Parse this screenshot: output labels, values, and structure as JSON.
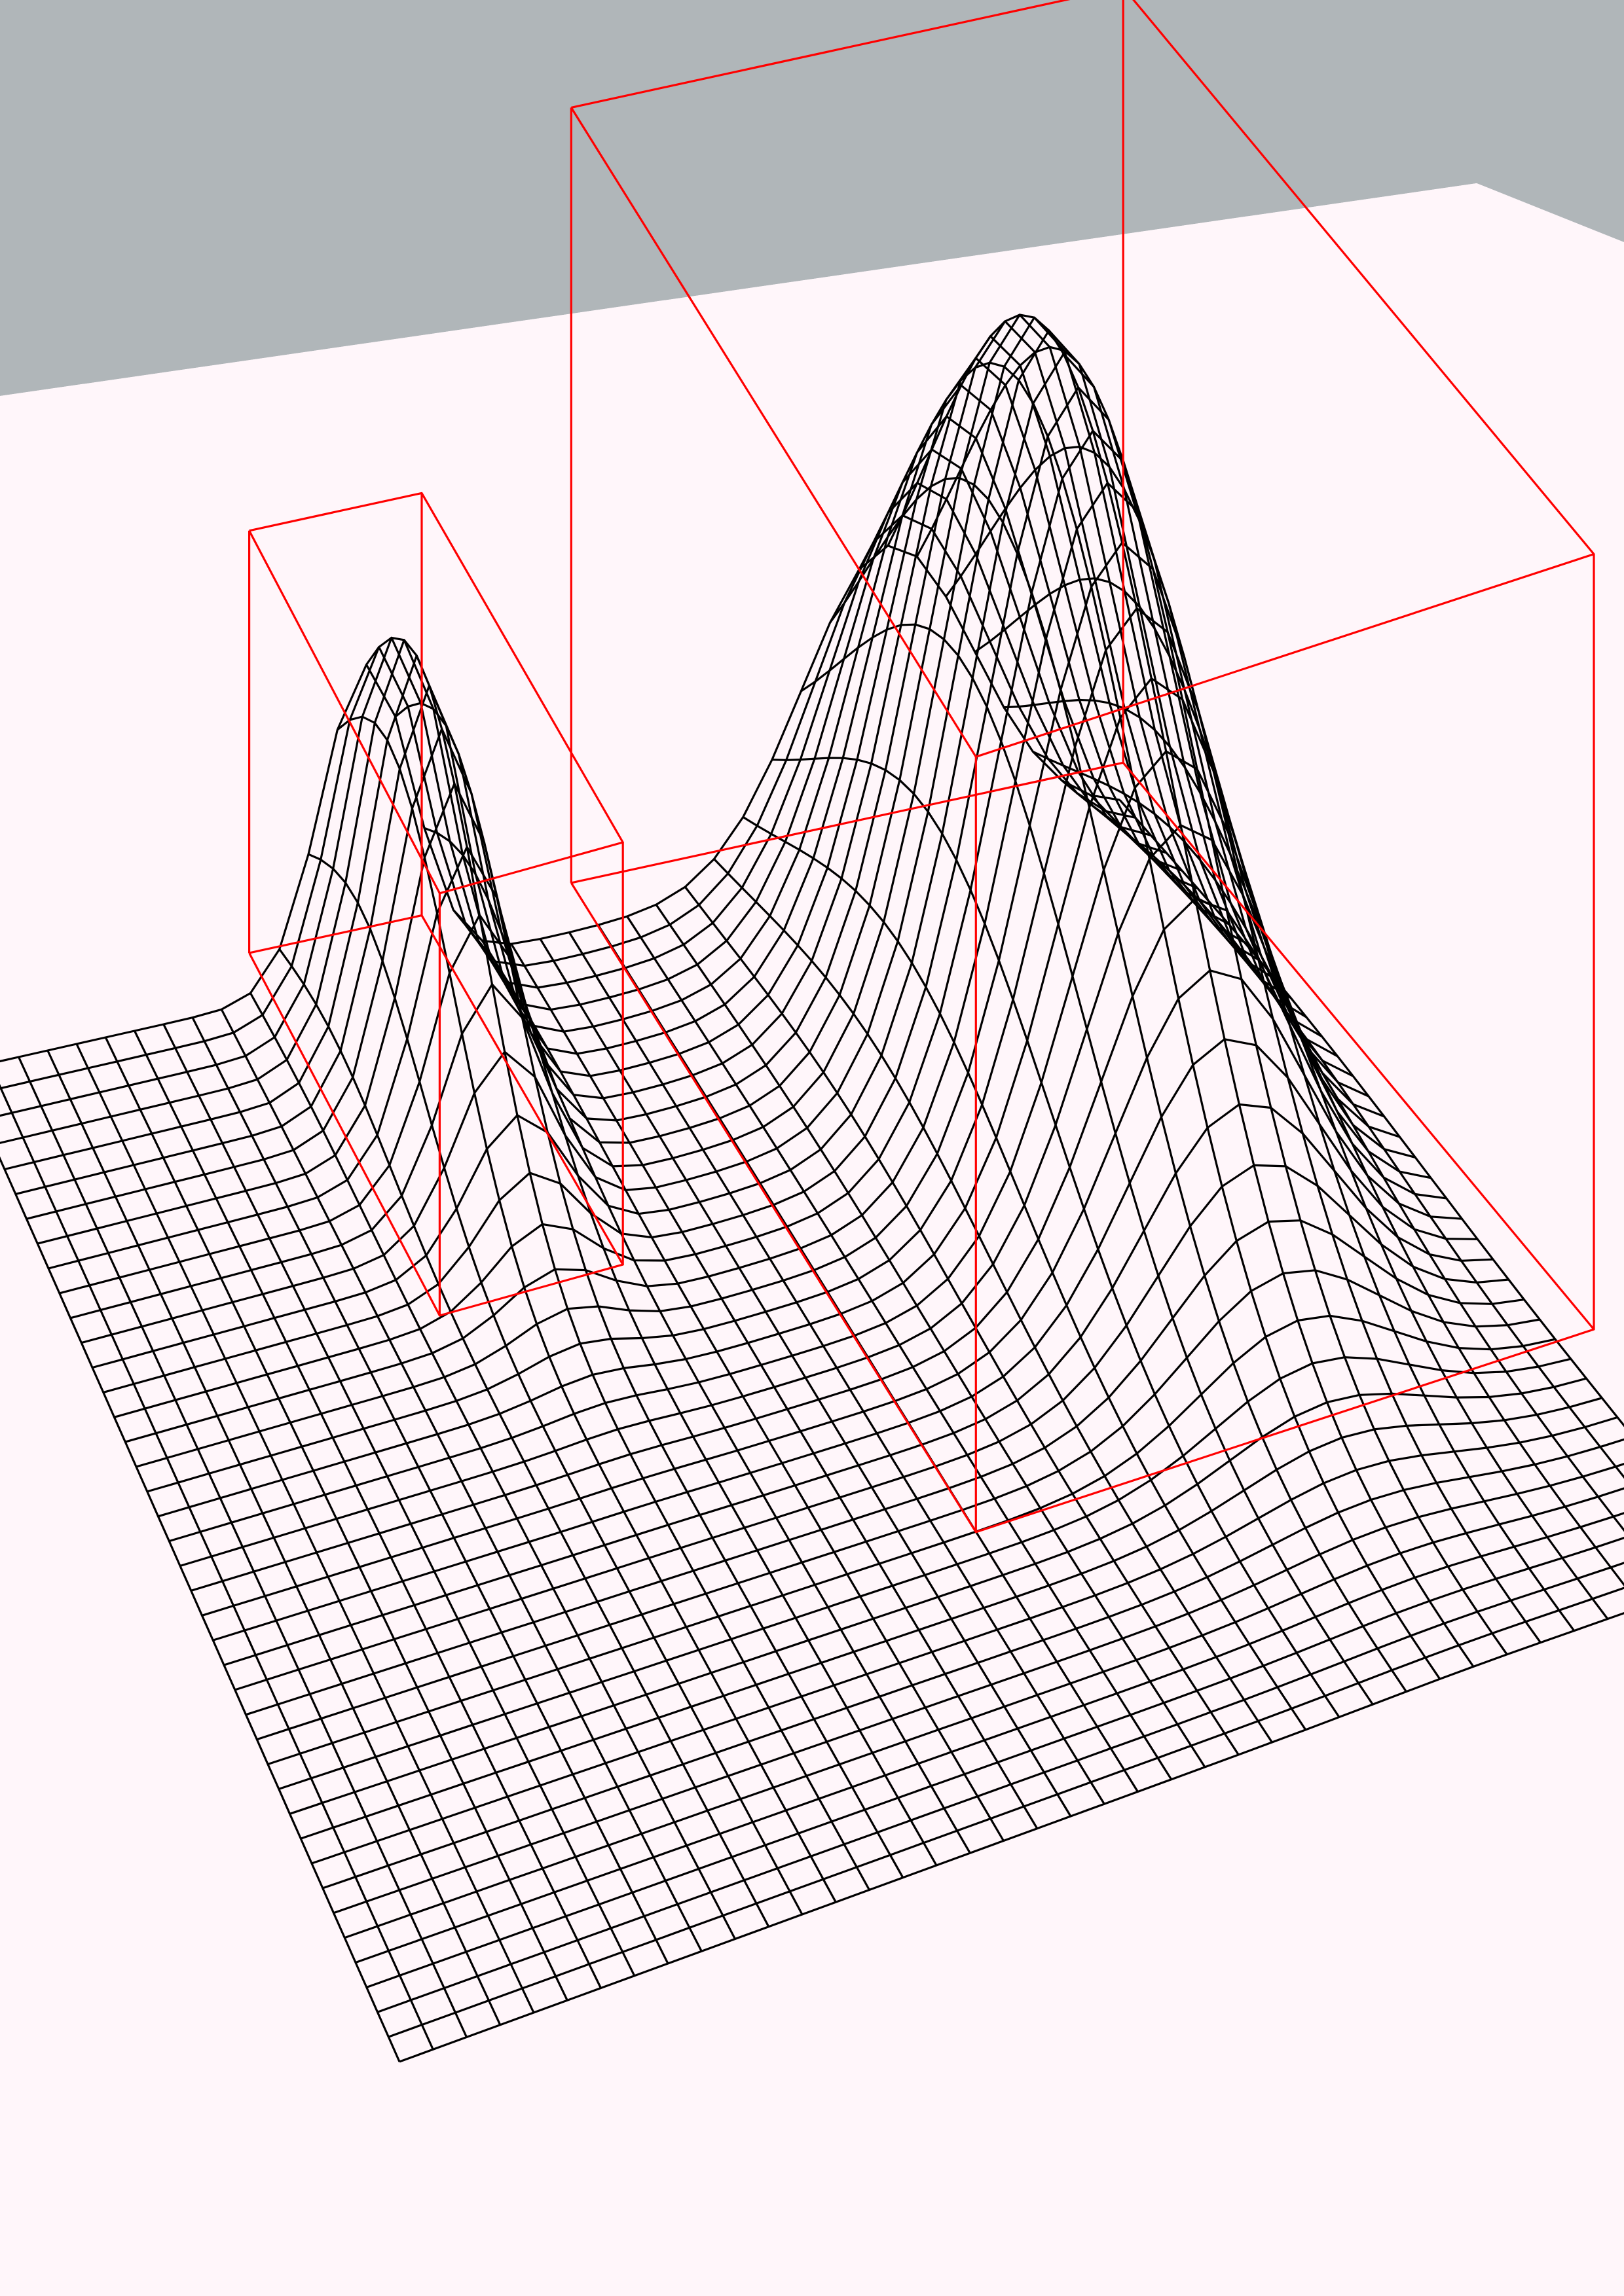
{
  "scene": {
    "type": "3d-wireframe-surface",
    "colors": {
      "background_sky": "#b0b6b9",
      "floor_plane": "#fff6fa",
      "mesh_lines": "#000000",
      "bounding_boxes": "#ff0000"
    },
    "mesh": {
      "grid_divisions": 40,
      "peaks": [
        {
          "name": "small-ridge",
          "relative_height": 0.55
        },
        {
          "name": "large-dome",
          "relative_height": 1.0
        }
      ]
    },
    "bounding_boxes": [
      "box-small-ridge",
      "box-large-dome"
    ]
  }
}
